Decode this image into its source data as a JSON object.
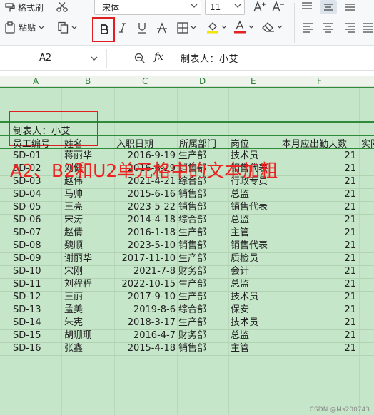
{
  "ribbon": {
    "format_painter": "格式刷",
    "paste": "粘贴",
    "font_name": "宋体",
    "font_size": "11"
  },
  "formula_bar": {
    "cell_ref": "A2",
    "fx": "fx",
    "value": "制表人：小艾"
  },
  "columns": [
    "A",
    "B",
    "C",
    "D",
    "E",
    "F"
  ],
  "sheet": {
    "title": "制表人：小艾",
    "headers": [
      "员工编号",
      "姓名",
      "入职日期",
      "所属部门",
      "岗位",
      "本月应出勤天数",
      "实际"
    ],
    "rows": [
      [
        "SD-01",
        "蒋丽华",
        "2016-9-19",
        "生产部",
        "技术员",
        "21"
      ],
      [
        "SD-02",
        "刘健",
        "2016-6-29",
        "销售部",
        "销售代表",
        "21"
      ],
      [
        "SD-03",
        "赵伟",
        "2021-4-21",
        "综合部",
        "行政专员",
        "21"
      ],
      [
        "SD-04",
        "马帅",
        "2015-6-16",
        "销售部",
        "总监",
        "21"
      ],
      [
        "SD-05",
        "王亮",
        "2023-5-22",
        "销售部",
        "销售代表",
        "21"
      ],
      [
        "SD-06",
        "宋涛",
        "2014-4-18",
        "综合部",
        "总监",
        "21"
      ],
      [
        "SD-07",
        "赵倩",
        "2016-1-18",
        "生产部",
        "主管",
        "21"
      ],
      [
        "SD-08",
        "魏顺",
        "2023-5-10",
        "销售部",
        "销售代表",
        "21"
      ],
      [
        "SD-09",
        "谢丽华",
        "2017-11-10",
        "生产部",
        "质检员",
        "21"
      ],
      [
        "SD-10",
        "宋刚",
        "2021-7-8",
        "财务部",
        "会计",
        "21"
      ],
      [
        "SD-11",
        "刘程程",
        "2022-10-15",
        "生产部",
        "总监",
        "21"
      ],
      [
        "SD-12",
        "王丽",
        "2017-9-10",
        "生产部",
        "技术员",
        "21"
      ],
      [
        "SD-13",
        "孟美",
        "2019-8-6",
        "综合部",
        "保安",
        "21"
      ],
      [
        "SD-14",
        "朱宪",
        "2018-3-17",
        "生产部",
        "技术员",
        "21"
      ],
      [
        "SD-15",
        "胡珊珊",
        "2016-4-7",
        "财务部",
        "总监",
        "21"
      ],
      [
        "SD-16",
        "张鑫",
        "2015-4-18",
        "销售部",
        "主管",
        "21"
      ]
    ]
  },
  "annotation": "A2、B2和U2单元格中的文本加粗",
  "watermark": "CSDN @Ms200743",
  "colors": {
    "sheet_bg": "#c5e6c8",
    "highlight": "#e02020",
    "grid_green": "#2f8a3a"
  }
}
